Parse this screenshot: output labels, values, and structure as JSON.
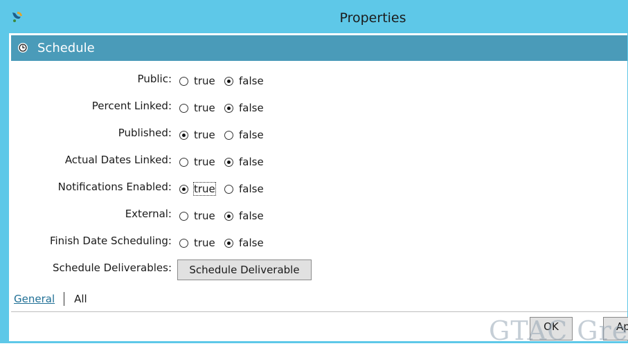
{
  "window": {
    "title": "Properties"
  },
  "section": {
    "title": "Schedule"
  },
  "properties": [
    {
      "label": "Public:",
      "options": [
        {
          "label": "true",
          "checked": false
        },
        {
          "label": "false",
          "checked": true
        }
      ]
    },
    {
      "label": "Percent Linked:",
      "options": [
        {
          "label": "true",
          "checked": false
        },
        {
          "label": "false",
          "checked": true
        }
      ]
    },
    {
      "label": "Published:",
      "options": [
        {
          "label": "true",
          "checked": true
        },
        {
          "label": "false",
          "checked": false
        }
      ]
    },
    {
      "label": "Actual Dates Linked:",
      "options": [
        {
          "label": "true",
          "checked": false
        },
        {
          "label": "false",
          "checked": true
        }
      ]
    },
    {
      "label": "Notifications Enabled:",
      "options": [
        {
          "label": "true",
          "checked": true,
          "focused": true
        },
        {
          "label": "false",
          "checked": false
        }
      ]
    },
    {
      "label": "External:",
      "options": [
        {
          "label": "true",
          "checked": false
        },
        {
          "label": "false",
          "checked": true
        }
      ]
    },
    {
      "label": "Finish Date Scheduling:",
      "options": [
        {
          "label": "true",
          "checked": false
        },
        {
          "label": "false",
          "checked": true
        }
      ]
    }
  ],
  "deliverables": {
    "label": "Schedule Deliverables:",
    "button_label": "Schedule Deliverable"
  },
  "tabs": {
    "general": "General",
    "all": "All"
  },
  "footer": {
    "ok_label": "OK",
    "apply_label": "Ap"
  },
  "watermark": {
    "text": "GTAC Grea"
  },
  "colors": {
    "titlebar": "#5ec8e8",
    "section_header": "#4a9bb9",
    "link": "#1f6f95"
  }
}
